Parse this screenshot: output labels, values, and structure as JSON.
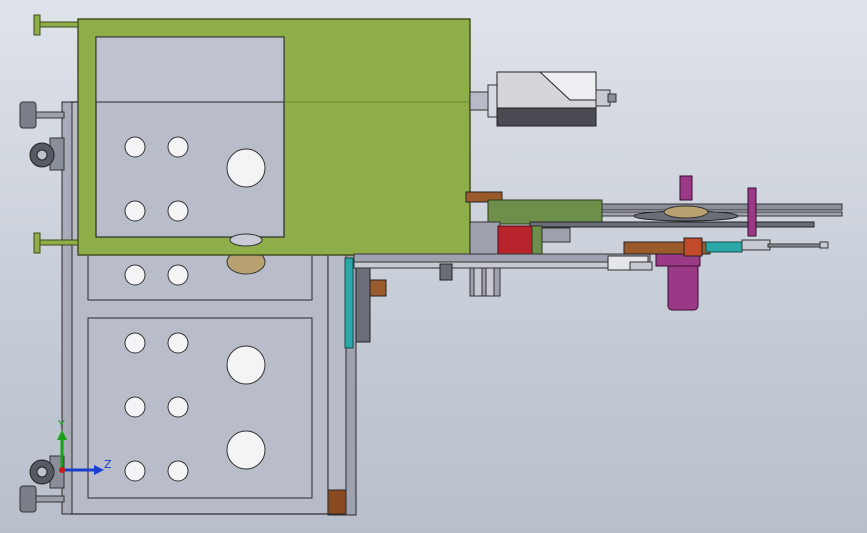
{
  "viewport": {
    "background_top": "#dfe3ea",
    "background_bottom": "#b8bfcb"
  },
  "colors": {
    "cabinet_fill": "#b7bac7",
    "cabinet_stroke": "#2a2a2a",
    "enclosure_fill": "#8fae4a",
    "enclosure_stroke": "#3c4a1a",
    "hole_fill": "#f4f4f6",
    "motor_purple": "#9a3a86",
    "block_red": "#b8242c",
    "rail_green": "#6d8f4a",
    "bracket_brown": "#9b5a2a",
    "camera_dark": "#4a4a52",
    "axis_y": "#1aa01a",
    "axis_z": "#1a3fd0",
    "axis_x": "#d01a1a"
  },
  "triad": {
    "y_label": "Y",
    "z_label": "Z"
  }
}
